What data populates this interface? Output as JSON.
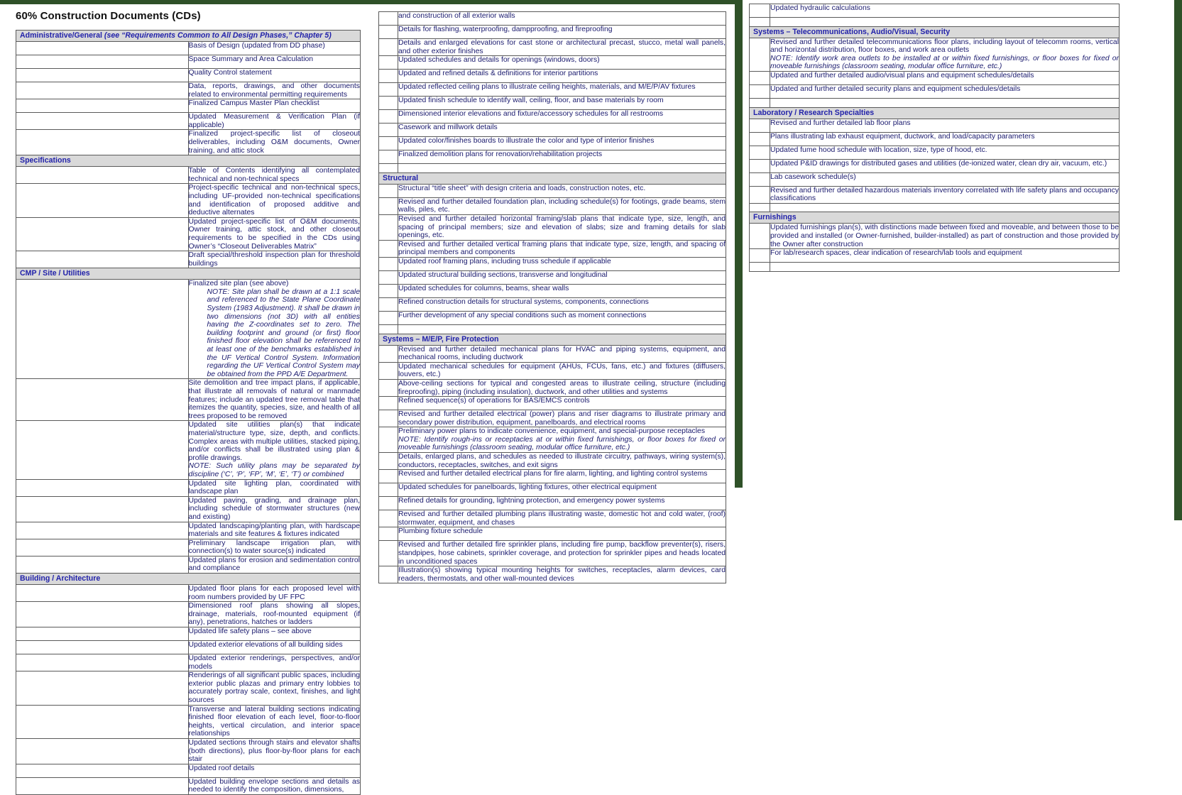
{
  "document": {
    "title": "60% Construction Documents (CDs)",
    "accent_header_bg": "#d9d9d9",
    "accent_text": "#2222aa",
    "separator_color": "#2f5128",
    "body_text_color": "#1a1a6e"
  },
  "columns": [
    {
      "id": "column-1",
      "blocks": [
        {
          "type": "section",
          "label": "Administrative/General",
          "label_italic": " (see “Requirements Common to All Design Phases,” Chapter 5)"
        },
        {
          "type": "row",
          "text": "Basis of Design (updated from DD phase)"
        },
        {
          "type": "row",
          "text": "Space Summary and Area Calculation"
        },
        {
          "type": "row",
          "text": "Quality Control statement"
        },
        {
          "type": "row",
          "text": "Data, reports, drawings, and other documents related to environmental permitting requirements"
        },
        {
          "type": "row",
          "text": "Finalized Campus Master Plan checklist"
        },
        {
          "type": "row",
          "text": "Updated Measurement & Verification Plan (if applicable)"
        },
        {
          "type": "row",
          "text": "Finalized project-specific list of closeout deliverables, including O&M documents, Owner training, and attic stock"
        },
        {
          "type": "section",
          "label": "Specifications",
          "label_italic": ""
        },
        {
          "type": "row",
          "text": "Table of Contents identifying all contemplated technical and non-technical specs"
        },
        {
          "type": "row",
          "text": "Project-specific technical and non-technical specs, including UF-provided non-technical specifications and identification of proposed additive and deductive alternates"
        },
        {
          "type": "row",
          "text": "Updated project-specific list of O&M documents, Owner training, attic stock, and other closeout requirements to be specified in the CDs using Owner’s “Closeout Deliverables Matrix”"
        },
        {
          "type": "row",
          "text": "Draft special/threshold inspection plan for threshold buildings"
        },
        {
          "type": "section",
          "label": "CMP / Site / Utilities",
          "label_italic": ""
        },
        {
          "type": "row_note",
          "text": "Finalized site plan (see above)",
          "note": "NOTE: Site plan shall be drawn at a 1:1 scale and referenced to the State Plane Coordinate System (1983 Adjustment).  It shall be drawn in two dimensions (not 3D) with all entities having the Z-coordinates set to zero.  The building footprint and ground (or first) floor finished floor elevation shall be referenced to at least one of the benchmarks established in the UF Vertical Control System.  Information regarding the UF Vertical Control System may be obtained from the PPD A/E Department."
        },
        {
          "type": "row",
          "text": "Site demolition and tree impact plans, if applicable, that illustrate all removals of natural or manmade features; include an updated tree removal table that itemizes the quantity, species, size, and health of all trees proposed to be removed"
        },
        {
          "type": "row_note_inline",
          "text": "Updated site utilities plan(s) that indicate material/structure type, size, depth, and conflicts. Complex areas with multiple utilities, stacked piping, and/or conflicts shall be illustrated using plan & profile drawings.",
          "note": "NOTE:  Such utility plans may be separated by discipline (‘C’, ‘P’, ‘FP’, ‘M’, ‘E’, ‘T’) or combined"
        },
        {
          "type": "row",
          "text": "Updated site lighting plan, coordinated with landscape plan"
        },
        {
          "type": "row",
          "text": "Updated paving, grading, and drainage plan, including schedule of stormwater structures (new and existing)"
        },
        {
          "type": "row",
          "text": "Updated landscaping/planting plan, with hardscape materials and site features & fixtures indicated"
        },
        {
          "type": "row",
          "text": "Preliminary landscape irrigation plan, with connection(s) to water source(s) indicated"
        },
        {
          "type": "row",
          "text": "Updated plans for erosion and sedimentation control and compliance"
        },
        {
          "type": "section",
          "label": "Building / Architecture",
          "label_italic": ""
        },
        {
          "type": "row",
          "text": "Updated floor plans for each proposed level with room numbers provided by UF FPC"
        },
        {
          "type": "row",
          "text": "Dimensioned roof plans showing all slopes, drainage, materials, roof-mounted equipment (if any), penetrations, hatches or ladders"
        },
        {
          "type": "row",
          "text": "Updated life safety plans – see above"
        },
        {
          "type": "row",
          "text": "Updated exterior elevations of all building sides"
        },
        {
          "type": "row",
          "text": "Updated exterior renderings, perspectives, and/or models"
        },
        {
          "type": "row",
          "text": "Renderings of all significant public spaces, including exterior public plazas and primary entry lobbies to accurately portray scale, context, finishes, and light sources"
        },
        {
          "type": "row",
          "text": "Transverse and lateral building sections indicating finished floor elevation of each level, floor-to-floor heights, vertical circulation, and interior space relationships"
        },
        {
          "type": "row",
          "text": "Updated sections through stairs and elevator shafts (both directions), plus floor-by-floor plans for each stair"
        },
        {
          "type": "row",
          "text": "Updated roof details"
        },
        {
          "type": "row",
          "text": "Updated building envelope sections and details as needed to identify the composition, dimensions,"
        }
      ]
    },
    {
      "id": "column-2",
      "blocks": [
        {
          "type": "row",
          "text": "and construction of all exterior walls"
        },
        {
          "type": "row",
          "text": "Details for flashing, waterproofing, dampproofing, and fireproofing"
        },
        {
          "type": "row",
          "text": "Details and enlarged elevations for cast stone or architectural precast, stucco, metal wall panels, and other exterior finishes"
        },
        {
          "type": "row",
          "text": "Updated schedules and details for openings (windows, doors)"
        },
        {
          "type": "row",
          "text": "Updated and refined details & definitions for interior partitions"
        },
        {
          "type": "row",
          "text": "Updated reflected ceiling plans to illustrate ceiling heights, materials, and M/E/P/AV fixtures"
        },
        {
          "type": "row",
          "text": "Updated finish schedule to identify wall, ceiling, floor, and base materials by room"
        },
        {
          "type": "row",
          "text": "Dimensioned interior elevations and fixture/accessory schedules for all restrooms"
        },
        {
          "type": "row",
          "text": "Casework and millwork details"
        },
        {
          "type": "row",
          "text": "Updated color/finishes boards to illustrate the color and type of interior finishes"
        },
        {
          "type": "row",
          "text": "Finalized demolition plans for renovation/rehabilitation projects"
        },
        {
          "type": "blank"
        },
        {
          "type": "section",
          "label": "Structural",
          "label_italic": ""
        },
        {
          "type": "row",
          "text": "Structural “title sheet” with design criteria and loads, construction notes, etc."
        },
        {
          "type": "row",
          "text": "Revised and further detailed foundation plan, including schedule(s) for footings, grade beams, stem walls, piles, etc."
        },
        {
          "type": "row",
          "text": "Revised and further detailed horizontal framing/slab plans that indicate type, size, length, and spacing of principal members; size and elevation of slabs; size and framing details for slab openings, etc."
        },
        {
          "type": "row",
          "text": "Revised and further detailed vertical framing plans that indicate type, size, length, and spacing of principal members and components"
        },
        {
          "type": "row",
          "text": "Updated roof framing plans, including truss schedule if applicable"
        },
        {
          "type": "row",
          "text": "Updated structural building sections, transverse and longitudinal"
        },
        {
          "type": "row",
          "text": "Updated schedules for columns, beams, shear walls"
        },
        {
          "type": "row",
          "text": "Refined construction details for structural systems, components, connections"
        },
        {
          "type": "row",
          "text": "Further development of any special conditions such as moment connections"
        },
        {
          "type": "blank"
        },
        {
          "type": "section",
          "label": "Systems – M/E/P, Fire Protection",
          "label_italic": ""
        },
        {
          "type": "row",
          "text": "Revised and further detailed mechanical plans for HVAC and piping systems, equipment, and mechanical rooms, including ductwork"
        },
        {
          "type": "row",
          "text": "Updated mechanical schedules for equipment (AHUs, FCUs, fans, etc.) and fixtures (diffusers, louvers, etc.)"
        },
        {
          "type": "row",
          "text": "Above-ceiling sections for typical and congested areas to illustrate ceiling, structure (including fireproofing), piping (including insulation), ductwork, and other utilities and systems"
        },
        {
          "type": "row",
          "text": "Refined sequence(s) of operations for BAS/EMCS controls"
        },
        {
          "type": "row",
          "text": "Revised and further detailed electrical (power) plans and riser diagrams to illustrate primary and secondary power distribution, equipment, panelboards, and electrical rooms"
        },
        {
          "type": "row_note_inline",
          "text": "Preliminary power plans to indicate convenience, equipment, and special-purpose receptacles",
          "note": "NOTE: Identify rough-ins or receptacles at or within fixed furnishings, or floor boxes for fixed or moveable furnishings (classroom seating, modular office furniture, etc.)"
        },
        {
          "type": "row",
          "text": "Details, enlarged plans, and schedules as needed to illustrate circuitry, pathways, wiring system(s), conductors, receptacles, switches, and exit signs"
        },
        {
          "type": "row",
          "text": "Revised and further detailed electrical plans for fire alarm, lighting, and lighting control systems"
        },
        {
          "type": "row",
          "text": "Updated schedules for panelboards, lighting fixtures, other electrical equipment"
        },
        {
          "type": "row",
          "text": "Refined details for grounding, lightning protection, and emergency power systems"
        },
        {
          "type": "row",
          "text": "Revised and further detailed plumbing plans illustrating waste, domestic hot and cold water, (roof) stormwater, equipment, and chases"
        },
        {
          "type": "row",
          "text": "Plumbing fixture schedule"
        },
        {
          "type": "row",
          "text": "Revised and further detailed fire sprinkler plans, including fire pump, backflow preventer(s), risers, standpipes, hose cabinets, sprinkler coverage, and protection for sprinkler pipes and heads located in unconditioned spaces"
        },
        {
          "type": "row",
          "text": "Illustration(s) showing typical mounting heights for switches, receptacles, alarm devices, card readers, thermostats, and other wall-mounted devices"
        }
      ]
    },
    {
      "id": "column-3",
      "blocks": [
        {
          "type": "row",
          "text": "Updated hydraulic calculations"
        },
        {
          "type": "blank"
        },
        {
          "type": "section",
          "label": "Systems – Telecommunications, Audio/Visual, Security",
          "label_italic": ""
        },
        {
          "type": "row_note_inline",
          "text": "Revised and further detailed telecommunications floor plans, including layout of telecomm rooms, vertical and horizontal distribution, floor boxes, and work area outlets",
          "note": "NOTE: Identify work area outlets to be installed at or within fixed furnishings, or floor boxes for fixed or moveable furnishings (classroom seating, modular office furniture, etc.)"
        },
        {
          "type": "row",
          "text": "Updated and further detailed audio/visual plans and equipment schedules/details"
        },
        {
          "type": "row",
          "text": "Updated and further detailed security plans and equipment schedules/details"
        },
        {
          "type": "blank"
        },
        {
          "type": "section",
          "label": "Laboratory / Research Specialties",
          "label_italic": ""
        },
        {
          "type": "row",
          "text": "Revised and further detailed lab floor plans"
        },
        {
          "type": "row",
          "text": "Plans illustrating lab exhaust equipment, ductwork, and load/capacity parameters"
        },
        {
          "type": "row",
          "text": "Updated fume hood schedule with location, size, type of hood, etc."
        },
        {
          "type": "row",
          "text": "Updated P&ID drawings for distributed gases and utilities (de-ionized water, clean dry air, vacuum, etc.)"
        },
        {
          "type": "row",
          "text": "Lab casework schedule(s)"
        },
        {
          "type": "row",
          "text": "Revised and further detailed hazardous materials inventory correlated with life safety plans and occupancy classifications"
        },
        {
          "type": "blank"
        },
        {
          "type": "section",
          "label": "Furnishings",
          "label_italic": ""
        },
        {
          "type": "row",
          "text": "Updated furnishings plan(s), with distinctions made between fixed and moveable, and between those to be provided and installed (or Owner-furnished, builder-installed) as part of construction and those provided by the Owner after construction"
        },
        {
          "type": "row",
          "text": "For lab/research spaces, clear indication of research/lab tools and equipment"
        },
        {
          "type": "blank"
        }
      ]
    }
  ]
}
